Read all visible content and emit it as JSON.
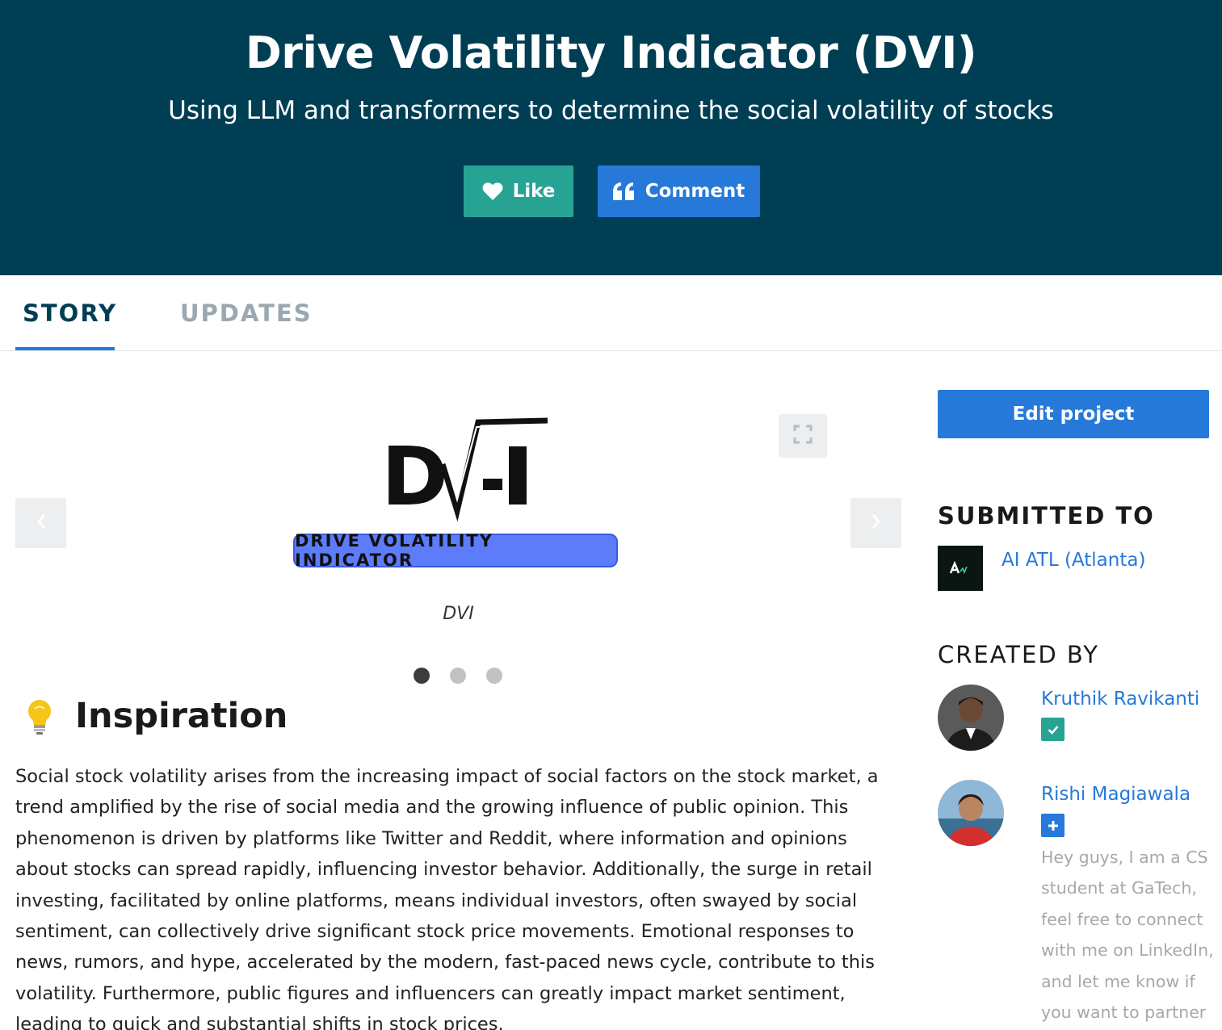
{
  "header": {
    "title": "Drive Volatility Indicator (DVI)",
    "tagline": "Using LLM and transformers to determine the social volatility of stocks",
    "like_label": "Like",
    "comment_label": "Comment",
    "colors": {
      "background": "#003e54",
      "like": "#27a394",
      "comment": "#2679d8"
    }
  },
  "tabs": [
    {
      "label": "STORY",
      "active": true
    },
    {
      "label": "UPDATES",
      "active": false
    }
  ],
  "gallery": {
    "logo_badge_text": "DRIVE VOLATILITY INDICATOR",
    "logo_letters": "DV-I",
    "caption": "DVI",
    "slide_count": 3,
    "active_slide": 1
  },
  "story": {
    "heading": "Inspiration",
    "heading_icon": "lightbulb-icon",
    "body": "Social stock volatility arises from the increasing impact of social factors on the stock market, a trend amplified by the rise of social media and the growing influence of public opinion. This phenomenon is driven by platforms like Twitter and Reddit, where information and opinions about stocks can spread rapidly, influencing investor behavior. Additionally, the surge in retail investing, facilitated by online platforms, means individual investors, often swayed by social sentiment, can collectively drive significant stock price movements. Emotional responses to news, rumors, and hype, accelerated by the modern, fast-paced news cycle, contribute to this volatility. Furthermore, public figures and influencers can greatly impact market sentiment, leading to quick and substantial shifts in stock prices."
  },
  "sidebar": {
    "edit_label": "Edit project",
    "submitted_heading": "SUBMITTED TO",
    "hackathon": "AI ATL (Atlanta)",
    "created_heading": "CREATED BY",
    "members": [
      {
        "name": "Kruthik Ravikanti",
        "badge": "check-icon"
      },
      {
        "name": "Rishi Magiawala",
        "badge": "plus-icon",
        "bio": "Hey guys, I am a CS student at GaTech, feel free to connect with me on LinkedIn, and let me know if you want to partner"
      }
    ]
  }
}
